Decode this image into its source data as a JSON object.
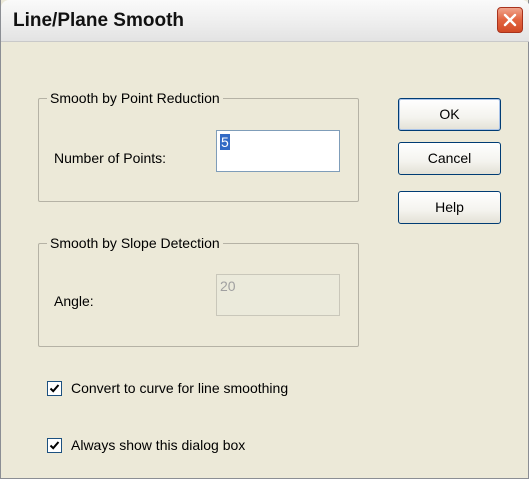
{
  "dialog": {
    "title": "Line/Plane Smooth"
  },
  "point_reduction": {
    "legend": "Smooth by Point Reduction",
    "label": "Number of Points:",
    "value": "5"
  },
  "slope_detection": {
    "legend": "Smooth by Slope Detection",
    "label": "Angle:",
    "value": "20",
    "disabled": true
  },
  "options": {
    "convert_to_curve": {
      "label": "Convert to curve for line smoothing",
      "checked": true
    },
    "always_show": {
      "label": "Always show this dialog box",
      "checked": true
    }
  },
  "buttons": {
    "ok": "OK",
    "cancel": "Cancel",
    "help": "Help"
  },
  "colors": {
    "dialog_bg": "#ece9d8",
    "close_button": "#d24a26",
    "selection": "#316ac5"
  }
}
